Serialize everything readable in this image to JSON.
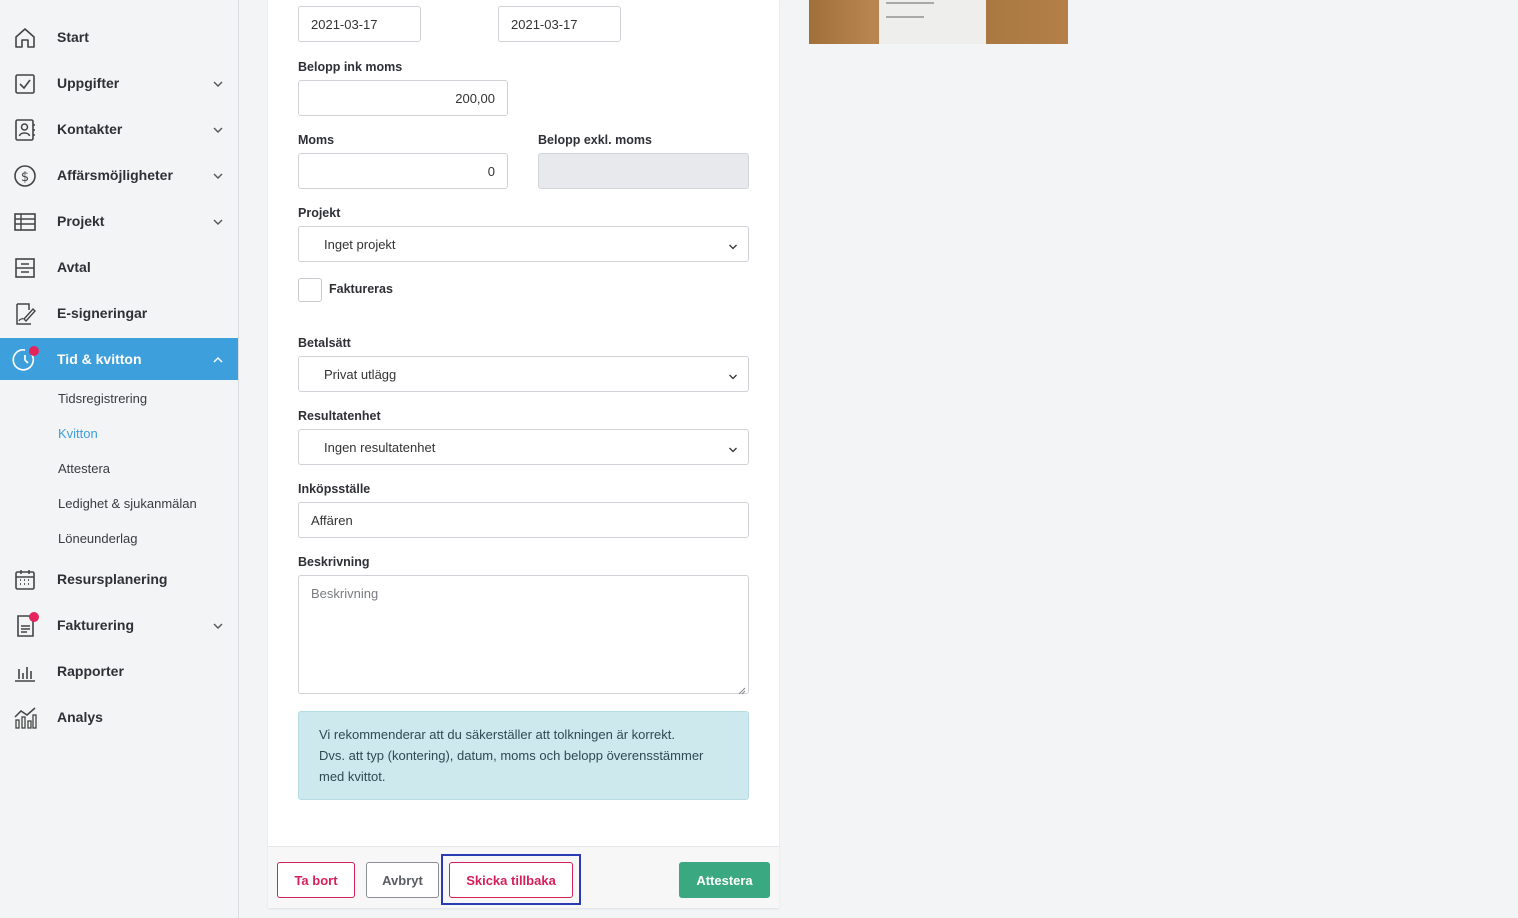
{
  "sidebar": {
    "items": [
      {
        "label": "Start",
        "icon": "home-icon",
        "chevron": false
      },
      {
        "label": "Uppgifter",
        "icon": "checkbox-icon",
        "chevron": true
      },
      {
        "label": "Kontakter",
        "icon": "contact-book-icon",
        "chevron": true
      },
      {
        "label": "Affärsmöjligheter",
        "icon": "dollar-circle-icon",
        "chevron": true
      },
      {
        "label": "Projekt",
        "icon": "table-icon",
        "chevron": true
      },
      {
        "label": "Avtal",
        "icon": "contract-icon",
        "chevron": false
      },
      {
        "label": "E-signeringar",
        "icon": "signature-icon",
        "chevron": false
      },
      {
        "label": "Tid & kvitton",
        "icon": "clock-icon",
        "chevron": true,
        "active": true,
        "badge": true
      },
      {
        "label": "Resursplanering",
        "icon": "calendar-icon",
        "chevron": false
      },
      {
        "label": "Fakturering",
        "icon": "invoice-icon",
        "chevron": true,
        "badge": true
      },
      {
        "label": "Rapporter",
        "icon": "bar-chart-icon",
        "chevron": false
      },
      {
        "label": "Analys",
        "icon": "analytics-icon",
        "chevron": false
      }
    ],
    "subitems": [
      {
        "label": "Tidsregistrering"
      },
      {
        "label": "Kvitton",
        "active": true
      },
      {
        "label": "Attestera"
      },
      {
        "label": "Ledighet & sjukanmälan"
      },
      {
        "label": "Löneunderlag"
      }
    ]
  },
  "form": {
    "date_from": "2021-03-17",
    "date_to": "2021-03-17",
    "amount_label": "Belopp ink moms",
    "amount_value": "200,00",
    "vat_label": "Moms",
    "vat_value": "0",
    "amount_ex_label": "Belopp exkl. moms",
    "amount_ex_value": "",
    "project_label": "Projekt",
    "project_value": "Inget projekt",
    "invoiced_label": "Faktureras",
    "payment_label": "Betalsätt",
    "payment_value": "Privat utlägg",
    "unit_label": "Resultatenhet",
    "unit_value": "Ingen resultatenhet",
    "place_label": "Inköpsställe",
    "place_value": "Affären",
    "desc_label": "Beskrivning",
    "desc_placeholder": "Beskrivning",
    "info_lines": [
      "Vi rekommenderar att du säkerställer att tolkningen är korrekt.",
      "Dvs. att typ (kontering), datum, moms och belopp överensstämmer",
      "med kvittot."
    ]
  },
  "footer": {
    "delete": "Ta bort",
    "cancel": "Avbryt",
    "send_back": "Skicka tillbaka",
    "approve": "Attestera"
  },
  "colors": {
    "accent": "#3d9fdb",
    "danger": "#d6205a",
    "success": "#3aa981",
    "badge": "#e5245c"
  }
}
